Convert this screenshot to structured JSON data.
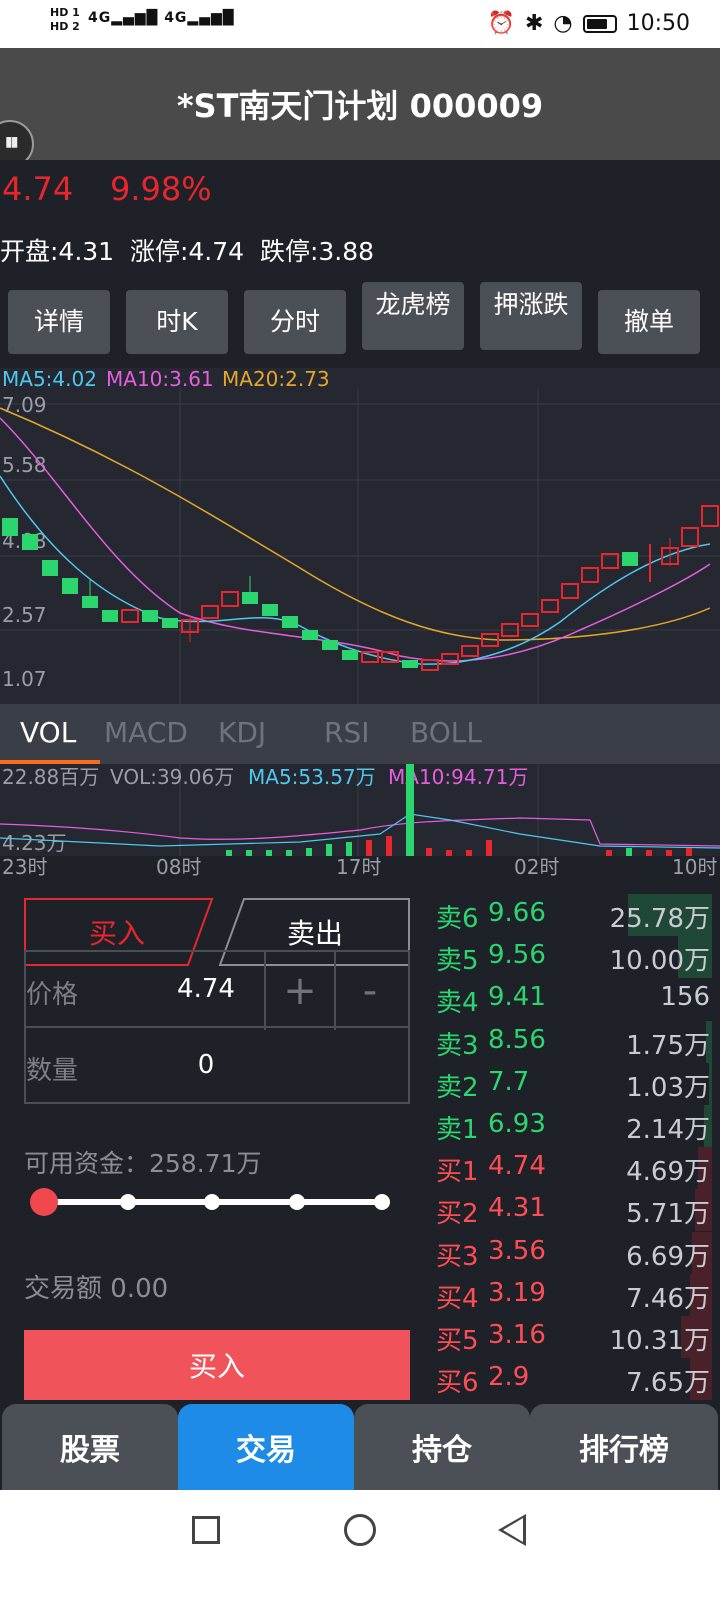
{
  "status": {
    "hd1": "HD 1",
    "hd2": "HD 2",
    "net1": "4G",
    "net2": "4G",
    "time": "10:50"
  },
  "header": {
    "title": "*ST南天门计划 000009"
  },
  "quote": {
    "price": "4.74",
    "change_pct": "9.98%",
    "info": "开盘:4.31  涨停:4.74  跌停:3.88"
  },
  "quick_buttons": [
    "详情",
    "时K",
    "分时",
    "龙虎榜",
    "押涨跌",
    "撤单"
  ],
  "kline": {
    "ma_labels": [
      {
        "text": "MA5:4.02",
        "color": "#4fc8f0"
      },
      {
        "text": "MA10:3.61",
        "color": "#e65ee0"
      },
      {
        "text": "MA20:2.73",
        "color": "#e5a72a"
      }
    ],
    "y_ticks": [
      "7.09",
      "5.58",
      "4.08",
      "2.57",
      "1.07"
    ]
  },
  "indicator_tabs": [
    "VOL",
    "MACD",
    "KDJ",
    "RSI",
    "BOLL"
  ],
  "volume": {
    "top_label": "22.88百万",
    "vol_text": "VOL:39.06万",
    "ma5_text": "MA5:53.57万",
    "ma10_text": "MA10:94.71万",
    "bottom_label": "4.23万",
    "x_ticks": [
      "23时",
      "08时",
      "17时",
      "02时",
      "10时"
    ]
  },
  "trade": {
    "buy_tab": "买入",
    "sell_tab": "卖出",
    "price_label": "价格",
    "price_value": "4.74",
    "plus": "+",
    "minus": "-",
    "qty_label": "数量",
    "qty_value": "0",
    "available": "可用资金：258.71万",
    "amount": "交易额 0.00",
    "buy_button": "买入"
  },
  "orderbook": [
    {
      "side": "卖6",
      "price": "9.66",
      "vol": "25.78万",
      "type": "sell",
      "share": 0.3
    },
    {
      "side": "卖5",
      "price": "9.56",
      "vol": "10.00万",
      "type": "sell",
      "share": 0.12
    },
    {
      "side": "卖4",
      "price": "9.41",
      "vol": "156",
      "type": "sell",
      "share": 0
    },
    {
      "side": "卖3",
      "price": "8.56",
      "vol": "1.75万",
      "type": "sell",
      "share": 0.02
    },
    {
      "side": "卖2",
      "price": "7.7",
      "vol": "1.03万",
      "type": "sell",
      "share": 0.01
    },
    {
      "side": "卖1",
      "price": "6.93",
      "vol": "2.14万",
      "type": "sell",
      "share": 0.03
    },
    {
      "side": "买1",
      "price": "4.74",
      "vol": "4.69万",
      "type": "buy",
      "share": 0.05
    },
    {
      "side": "买2",
      "price": "4.31",
      "vol": "5.71万",
      "type": "buy",
      "share": 0.06
    },
    {
      "side": "买3",
      "price": "3.56",
      "vol": "6.69万",
      "type": "buy",
      "share": 0.07
    },
    {
      "side": "买4",
      "price": "3.19",
      "vol": "7.46万",
      "type": "buy",
      "share": 0.08
    },
    {
      "side": "买5",
      "price": "3.16",
      "vol": "10.31万",
      "type": "buy",
      "share": 0.11
    },
    {
      "side": "买6",
      "price": "2.9",
      "vol": "7.65万",
      "type": "buy",
      "share": 0.08
    }
  ],
  "bottom_nav": [
    "股票",
    "交易",
    "持仓",
    "排行榜"
  ],
  "colors": {
    "up": "#e8262e",
    "down": "#2bd66f",
    "accent": "#1e8be6",
    "sell_green": "#2bd66f",
    "buy_red": "#ff4d55"
  }
}
